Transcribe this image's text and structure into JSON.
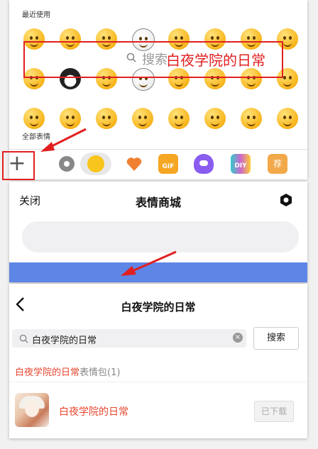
{
  "picker": {
    "recent_label": "最近使用",
    "all_label": "全部表情",
    "tabs": [
      "add",
      "settings",
      "emoji",
      "heart",
      "gif",
      "character",
      "diy",
      "recommend"
    ],
    "tab_gif_label": "GIF",
    "tab_diy_label": "DIY",
    "tab_recommend_label": "荐"
  },
  "mall": {
    "close_label": "关闭",
    "title": "表情商城",
    "search_placeholder": "搜索",
    "search_overlay_text": "白夜学院的日常"
  },
  "results": {
    "title": "白夜学院的日常",
    "query": "白夜学院的日常",
    "search_button": "搜索",
    "count_highlight": "白夜学院的日常",
    "count_suffix": "表情包(1)",
    "pack_name": "白夜学院的日常",
    "downloaded_label": "已下载"
  },
  "colors": {
    "highlight_red": "#e02020",
    "result_red": "#e8452e",
    "banner_blue": "#5e86e6",
    "emoji_yellow": "#f7b51b"
  }
}
